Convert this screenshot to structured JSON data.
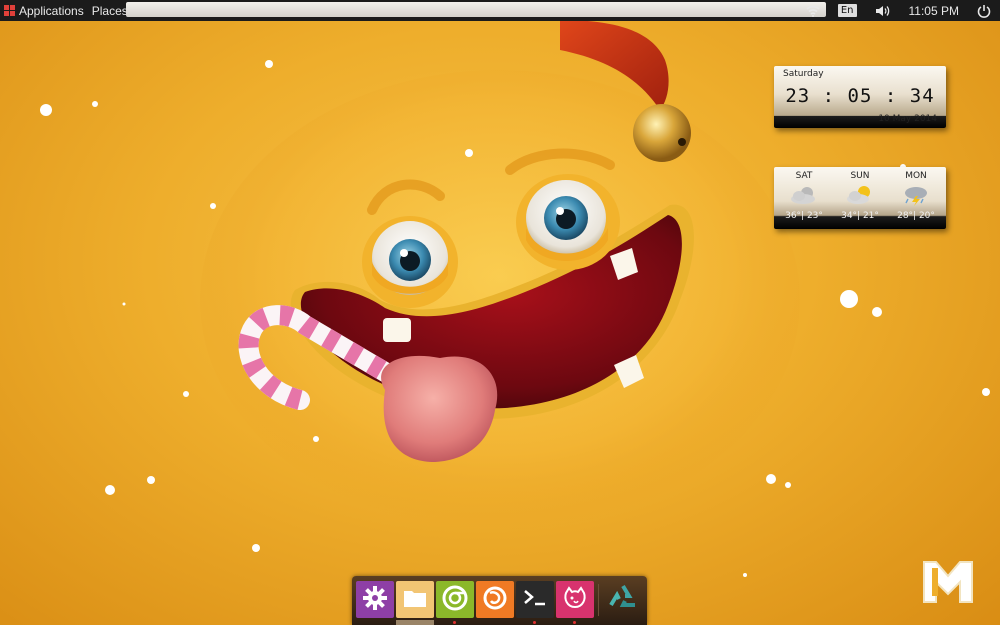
{
  "top_panel": {
    "menu": [
      "Applications",
      "Places"
    ],
    "tray": {
      "wifi_icon": "wifi-icon",
      "keyboard_layout": "En",
      "volume_icon": "volume-icon",
      "clock": "11:05 PM",
      "power_icon": "power-icon"
    }
  },
  "clock_widget": {
    "day": "Saturday",
    "time": "23 : 05 : 34",
    "date": "10 May 2014"
  },
  "weather_widget": {
    "days": [
      {
        "name": "SAT",
        "icon": "partly-cloudy-icon",
        "temp": "36°| 23°"
      },
      {
        "name": "SUN",
        "icon": "partly-sunny-icon",
        "temp": "34°| 21°"
      },
      {
        "name": "MON",
        "icon": "thunderstorm-icon",
        "temp": "28°| 20°"
      }
    ]
  },
  "dock": {
    "items": [
      {
        "name": "settings",
        "icon": "gear-icon",
        "color": "#8e3fa6",
        "running": false
      },
      {
        "name": "files",
        "icon": "folder-icon",
        "color": "#f0c070",
        "running": true
      },
      {
        "name": "chrome",
        "icon": "chrome-icon",
        "color": "#8bb82a",
        "running": true
      },
      {
        "name": "firefox",
        "icon": "firefox-icon",
        "color": "#f07a24",
        "running": false
      },
      {
        "name": "terminal",
        "icon": "terminal-icon",
        "color": "#2a2a2a",
        "running": true
      },
      {
        "name": "app",
        "icon": "cat-face-icon",
        "color": "#d8336e",
        "running": true
      },
      {
        "name": "trash",
        "icon": "recycle-icon",
        "color": "transparent",
        "running": false
      }
    ]
  },
  "colors": {
    "wallpaper": "#eeae2c",
    "panel": "#1b1b1b",
    "apps_icon": "#e0403a"
  }
}
